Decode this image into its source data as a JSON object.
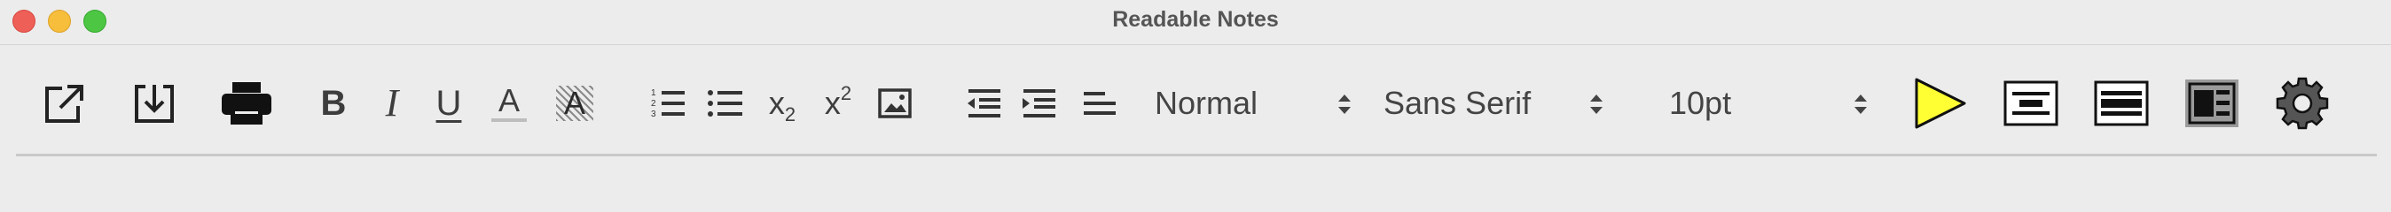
{
  "window": {
    "title": "Readable Notes"
  },
  "toolbar": {
    "paragraph_style": "Normal",
    "font_family": "Sans Serif",
    "font_size": "10pt",
    "bold_glyph": "B",
    "italic_glyph": "I",
    "underline_glyph": "U",
    "text_color_glyph": "A",
    "highlight_glyph": "A",
    "subscript_glyph": "x",
    "subscript_mark": "2",
    "superscript_glyph": "x",
    "superscript_mark": "2"
  },
  "icons": [
    "export-icon",
    "import-icon",
    "print-icon",
    "bold-icon",
    "italic-icon",
    "underline-icon",
    "text-color-icon",
    "highlight-icon",
    "ordered-list-icon",
    "bullet-list-icon",
    "subscript-icon",
    "superscript-icon",
    "image-icon",
    "outdent-icon",
    "indent-icon",
    "align-left-icon",
    "play-icon",
    "layout-narrow-icon",
    "layout-wide-icon",
    "layout-sidebar-icon",
    "gear-icon"
  ],
  "colors": {
    "play_fill": "#ffff33",
    "active_layout_bg": "#9a9a9a",
    "traffic_close": "#ee5f58",
    "traffic_minimize": "#f7be3b",
    "traffic_maximize": "#4dc743"
  }
}
